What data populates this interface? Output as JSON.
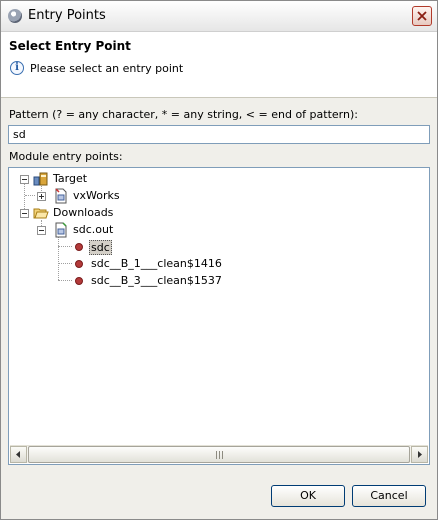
{
  "window": {
    "title": "Entry Points",
    "close_icon": "close-icon"
  },
  "header": {
    "title": "Select Entry Point",
    "message": "Please select an entry point",
    "info_icon": "info-icon"
  },
  "pattern": {
    "label": "Pattern (? = any character, * = any string, < = end of pattern):",
    "value": "sd"
  },
  "tree": {
    "label": "Module entry points:",
    "nodes": [
      {
        "label": "Target",
        "icon": "target-icon",
        "expanded": true
      },
      {
        "label": "vxWorks",
        "icon": "module-file-icon",
        "expanded": false
      },
      {
        "label": "Downloads",
        "icon": "folder-open-icon",
        "expanded": true
      },
      {
        "label": "sdc.out",
        "icon": "module-file-icon",
        "expanded": true
      },
      {
        "label": "sdc",
        "icon": "entry-point-icon",
        "selected": true
      },
      {
        "label": "sdc__B_1___clean$1416",
        "icon": "entry-point-icon"
      },
      {
        "label": "sdc__B_3___clean$1537",
        "icon": "entry-point-icon"
      }
    ]
  },
  "buttons": {
    "ok": "OK",
    "cancel": "Cancel"
  },
  "colors": {
    "selection": "#d4d0c8",
    "entry_point": "#b33a3a",
    "border": "#7f9db9"
  }
}
